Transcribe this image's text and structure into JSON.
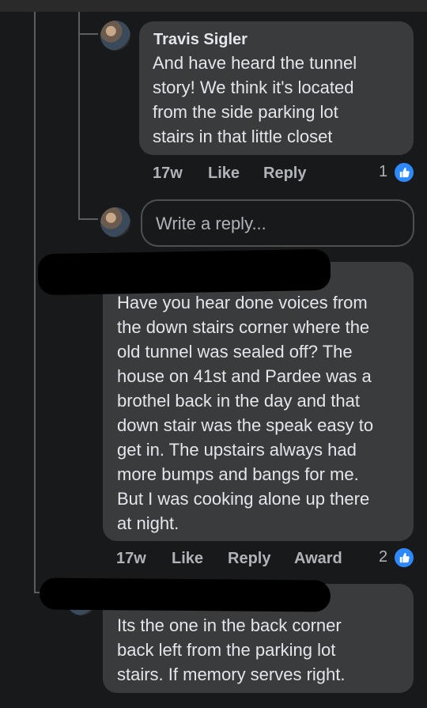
{
  "comments": [
    {
      "author": "Travis Sigler",
      "text": "And have heard the tunnel\nstory! We think it's located\nfrom the side parking lot\nstairs in that little closet",
      "time": "17w",
      "like_label": "Like",
      "reply_label": "Reply",
      "reaction_count": "1"
    },
    {
      "author": "",
      "text": "Have you hear done voices from\nthe down stairs corner where the\nold tunnel was sealed off? The\nhouse on 41st and Pardee was a\nbrothel back in the day and that\ndown stair was the speak easy to\nget in. The upstairs always had\nmore bumps and bangs for me.\nBut I was cooking alone up there\nat night.",
      "time": "17w",
      "like_label": "Like",
      "reply_label": "Reply",
      "award_label": "Award",
      "reaction_count": "2"
    },
    {
      "author": "",
      "text": "Its the one in the back corner\nback left from the parking lot\nstairs. If memory serves right."
    }
  ],
  "reply_input": {
    "placeholder": "Write a reply..."
  },
  "colors": {
    "background": "#18191a",
    "bubble": "#3a3b3c",
    "accent": "#2e89ff",
    "muted": "#b0b3b8"
  },
  "icons": {
    "reaction": "thumbs-up-icon"
  }
}
